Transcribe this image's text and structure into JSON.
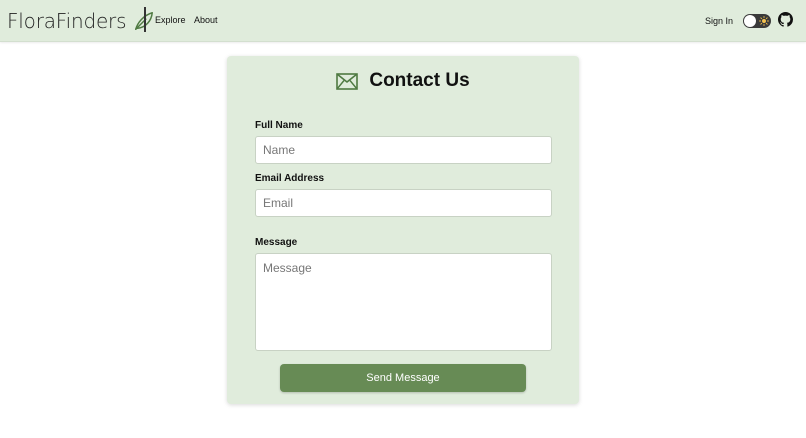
{
  "navbar": {
    "brand": "FloraFinders",
    "brand_icon": "leaf-icon",
    "links": [
      "Explore",
      "About"
    ],
    "sign_in": "Sign In",
    "theme_toggle_icon": "sun-icon",
    "github_icon": "github-icon"
  },
  "contact_form": {
    "title": "Contact Us",
    "title_icon": "mail-icon",
    "full_name": {
      "label": "Full Name",
      "placeholder": "Name",
      "value": ""
    },
    "email": {
      "label": "Email Address",
      "placeholder": "Email",
      "value": ""
    },
    "message": {
      "label": "Message",
      "placeholder": "Message",
      "value": ""
    },
    "submit_label": "Send Message"
  },
  "colors": {
    "navbar_bg": "#e0ecdc",
    "card_bg": "#e0ecdc",
    "accent": "#678b55",
    "icon_green": "#4f7a42"
  }
}
